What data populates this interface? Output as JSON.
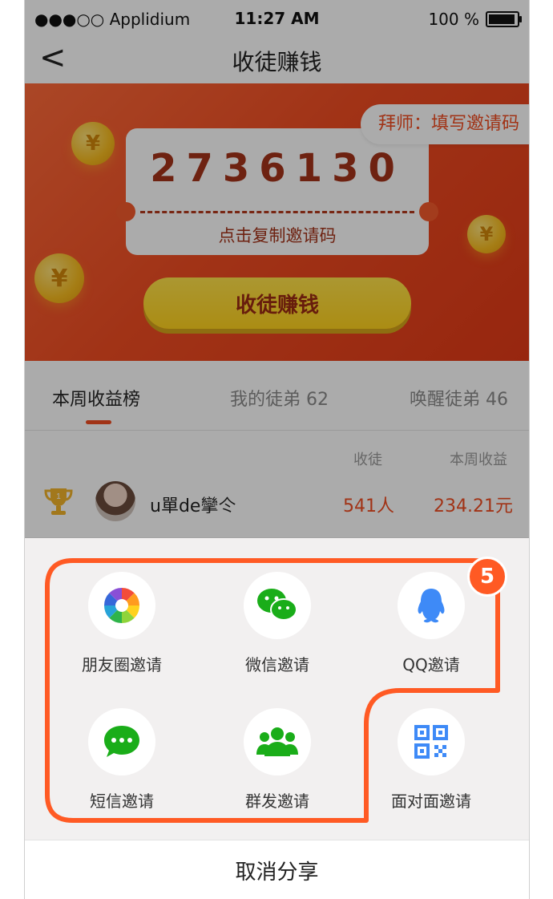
{
  "status_bar": {
    "carrier": "●●●○○ Applidium",
    "time": "11:27 AM",
    "battery": "100 %"
  },
  "nav": {
    "back": "<",
    "title": "收徒赚钱"
  },
  "banner": {
    "invite_code": "2736130",
    "copy_hint": "点击复制邀请码",
    "master_button": "拜师：填写邀请码",
    "earn_button": "收徒赚钱",
    "coin_symbol": "¥"
  },
  "tabs": [
    {
      "label": "本周收益榜"
    },
    {
      "label": "我的徒弟 62"
    },
    {
      "label": "唤醒徒弟 46"
    }
  ],
  "ranking": {
    "headers": {
      "count": "收徒",
      "income": "本周收益"
    },
    "rows": [
      {
        "rank": "1",
        "name": "u單de攣仒",
        "count": "541人",
        "income": "234.21元"
      }
    ]
  },
  "share": {
    "items": [
      {
        "label": "朋友圈邀请",
        "icon": "moments-icon"
      },
      {
        "label": "微信邀请",
        "icon": "wechat-icon"
      },
      {
        "label": "QQ邀请",
        "icon": "qq-icon"
      },
      {
        "label": "短信邀请",
        "icon": "sms-icon"
      },
      {
        "label": "群发邀请",
        "icon": "group-send-icon"
      },
      {
        "label": "面对面邀请",
        "icon": "qr-code-icon"
      }
    ],
    "badge": "5",
    "cancel_label": "取消分享"
  },
  "colors": {
    "accent": "#f04c22",
    "highlight_outline": "#ff5a24",
    "earn_button": "#ffd21e",
    "wechat_green": "#1aad19",
    "qq_blue": "#3e8af7"
  }
}
